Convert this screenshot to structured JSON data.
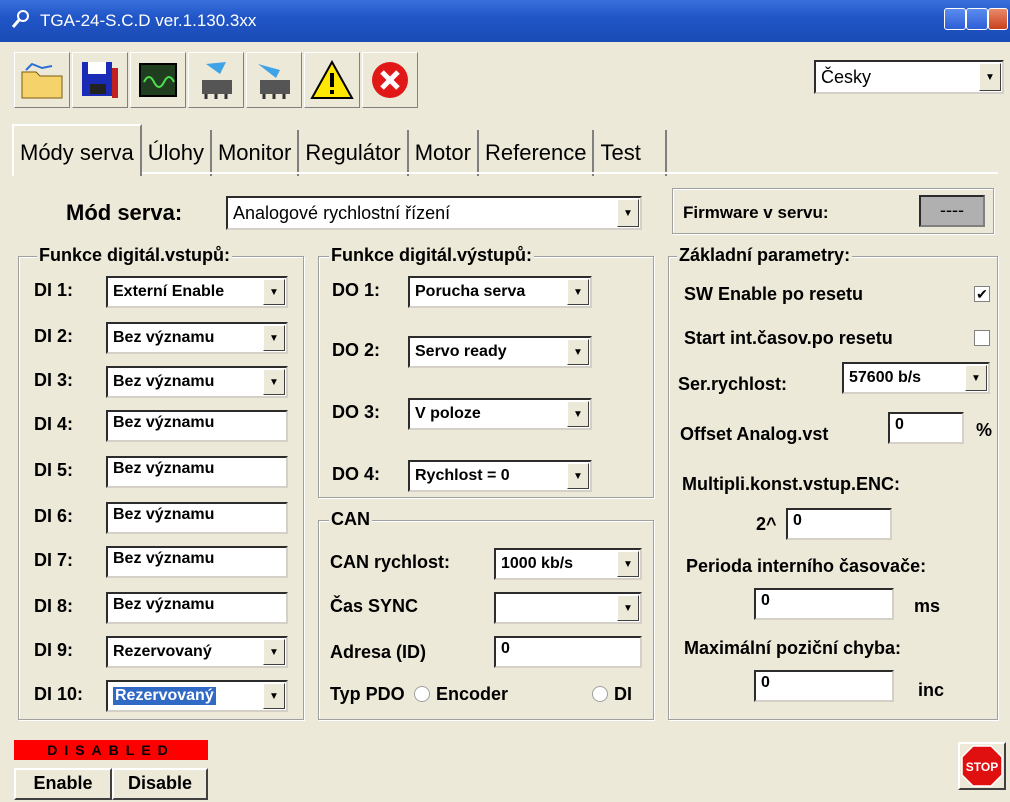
{
  "window": {
    "title": "TGA-24-S.C.D ver.1.130.3xx"
  },
  "toolbar": {
    "language": "Česky"
  },
  "tabs": [
    "Módy serva",
    "Úlohy",
    "Monitor",
    "Regulátor",
    "Motor",
    "Reference",
    "Test"
  ],
  "mode": {
    "label": "Mód serva:",
    "value": "Analogové rychlostní řízení"
  },
  "firmware": {
    "label": "Firmware v servu:",
    "value": "----"
  },
  "di": {
    "title": "Funkce digitál.vstupů:",
    "items": [
      {
        "label": "DI 1:",
        "value": "Externí Enable"
      },
      {
        "label": "DI 2:",
        "value": "Bez významu"
      },
      {
        "label": "DI 3:",
        "value": "Bez významu"
      },
      {
        "label": "DI 4:",
        "value": "Bez významu"
      },
      {
        "label": "DI 5:",
        "value": "Bez významu"
      },
      {
        "label": "DI 6:",
        "value": "Bez významu"
      },
      {
        "label": "DI 7:",
        "value": "Bez významu"
      },
      {
        "label": "DI 8:",
        "value": "Bez významu"
      },
      {
        "label": "DI 9:",
        "value": "Rezervovaný"
      },
      {
        "label": "DI 10:",
        "value": "Rezervovaný"
      }
    ]
  },
  "do": {
    "title": "Funkce digitál.výstupů:",
    "items": [
      {
        "label": "DO 1:",
        "value": "Porucha serva"
      },
      {
        "label": "DO 2:",
        "value": "Servo ready"
      },
      {
        "label": "DO 3:",
        "value": "V poloze"
      },
      {
        "label": "DO 4:",
        "value": "Rychlost = 0"
      }
    ]
  },
  "can": {
    "title": "CAN",
    "speed_label": "CAN rychlost:",
    "speed": "1000 kb/s",
    "sync_label": "Čas SYNC",
    "sync": "",
    "addr_label": "Adresa (ID)",
    "addr": "0",
    "pdo_label": "Typ PDO",
    "pdo_opt1": "Encoder",
    "pdo_opt2": "DI"
  },
  "basic": {
    "title": "Základní parametry:",
    "sw_enable": "SW Enable po resetu",
    "sw_enable_check": "✔",
    "start_timer": "Start int.časov.po resetu",
    "ser_speed_label": "Ser.rychlost:",
    "ser_speed": "57600 b/s",
    "offset_label": "Offset Analog.vst",
    "offset": "0",
    "offset_unit": "%",
    "multi_label": "Multipli.konst.vstup.ENC:",
    "multi_prefix": "2^",
    "multi": "0",
    "period_label": "Perioda interního časovače:",
    "period": "0",
    "period_unit": "ms",
    "maxerr_label": "Maximální poziční chyba:",
    "maxerr": "0",
    "maxerr_unit": "inc"
  },
  "status": {
    "text": "DISABLED",
    "enable": "Enable",
    "disable": "Disable",
    "stop": "STOP"
  }
}
